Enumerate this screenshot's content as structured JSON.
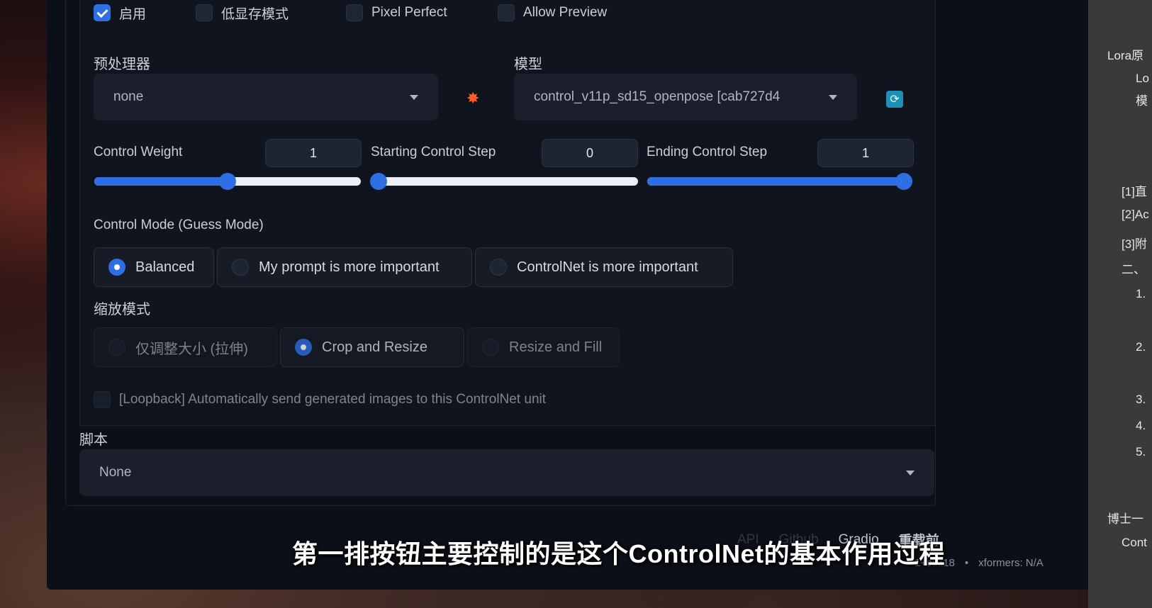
{
  "checkboxes": [
    {
      "label": "启用",
      "checked": true
    },
    {
      "label": "低显存模式",
      "checked": false
    },
    {
      "label": "Pixel Perfect",
      "checked": false
    },
    {
      "label": "Allow Preview",
      "checked": false
    }
  ],
  "preprocessor": {
    "label": "预处理器",
    "value": "none"
  },
  "model": {
    "label": "模型",
    "value": "control_v11p_sd15_openpose [cab727d4"
  },
  "control_weight": {
    "label": "Control Weight",
    "value": "1",
    "fraction": 0.5
  },
  "starting_step": {
    "label": "Starting Control Step",
    "value": "0",
    "fraction": 0.0
  },
  "ending_step": {
    "label": "Ending Control Step",
    "value": "1",
    "fraction": 1.0
  },
  "control_mode": {
    "label": "Control Mode (Guess Mode)",
    "options": [
      "Balanced",
      "My prompt is more important",
      "ControlNet is more important"
    ],
    "selected": "Balanced"
  },
  "resize_mode": {
    "label": "缩放模式",
    "options": [
      "仅调整大小 (拉伸)",
      "Crop and Resize",
      "Resize and Fill"
    ],
    "selected": "Crop and Resize"
  },
  "loopback": {
    "label": "[Loopback] Automatically send generated images to this ControlNet unit",
    "checked": false
  },
  "script": {
    "label": "脚本",
    "value": "None"
  },
  "footer": {
    "links": [
      "API",
      "Github",
      "Gradio",
      "重载前"
    ],
    "info": [
      "1+cu118",
      "xformers: N/A"
    ]
  },
  "subtitle": "第一排按钮主要控制的是这个ControlNet的基本作用过程",
  "sidebar": {
    "items": [
      "Lora原",
      "Lo",
      "模",
      "[1]直",
      "[2]Ac",
      "[3]附",
      "二、",
      "1.",
      "2.",
      "3.",
      "4.",
      "5.",
      "博士一",
      "Cont"
    ]
  },
  "colors": {
    "accent": "#2f6fe4",
    "background": "#0b0f17",
    "sidebar": "#3a3a3a"
  }
}
